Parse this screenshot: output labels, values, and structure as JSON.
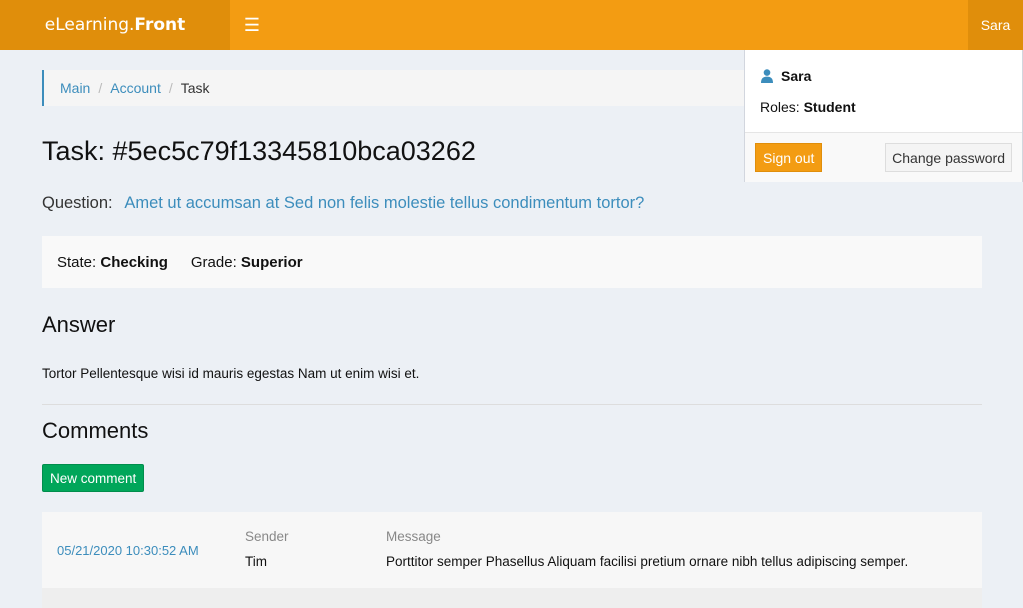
{
  "header": {
    "logo_prefix": "eLearning.",
    "logo_bold": "Front",
    "menu_icon": "hamburger-icon",
    "user_name": "Sara",
    "brand_color": "#f39c12"
  },
  "breadcrumb": {
    "items": [
      "Main",
      "Account"
    ],
    "current": "Task"
  },
  "task": {
    "title": "Task: #5ec5c79f13345810bca03262",
    "question_label": "Question:",
    "question_text": "Amet ut accumsan at Sed non felis molestie tellus condimentum tortor?",
    "state_label": "State:",
    "state_value": "Checking",
    "grade_label": "Grade:",
    "grade_value": "Superior"
  },
  "answer": {
    "heading": "Answer",
    "text": "Tortor Pellentesque wisi id mauris egestas Nam ut enim wisi et."
  },
  "comments": {
    "heading": "Comments",
    "new_button": "New comment",
    "sender_header": "Sender",
    "message_header": "Message",
    "items": [
      {
        "date": "05/21/2020 10:30:52 AM",
        "sender": "Tim",
        "message": "Porttitor semper Phasellus Aliquam facilisi pretium ornare nibh tellus adipiscing semper."
      }
    ]
  },
  "user_menu": {
    "name": "Sara",
    "roles_label": "Roles:",
    "roles_value": "Student",
    "signout_label": "Sign out",
    "change_password_label": "Change password",
    "icon": "user-icon"
  }
}
